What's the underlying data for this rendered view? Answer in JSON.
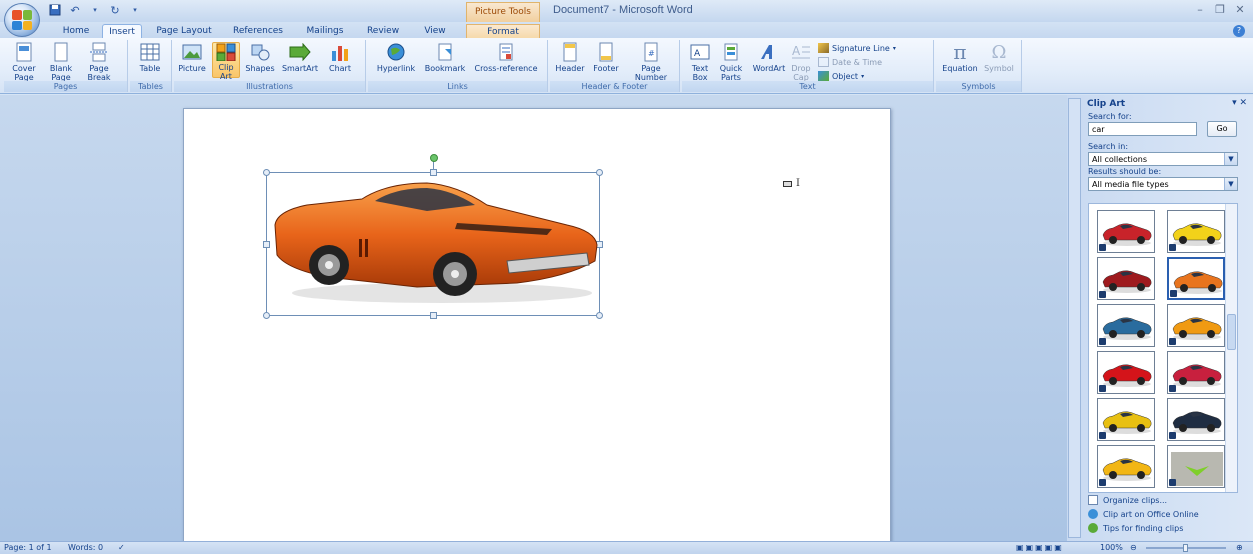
{
  "window": {
    "title": "Document7 - Microsoft Word",
    "context_tab_group": "Picture Tools"
  },
  "tabs": [
    "Home",
    "Insert",
    "Page Layout",
    "References",
    "Mailings",
    "Review",
    "View",
    "Format"
  ],
  "active_tab": "Insert",
  "ribbon": {
    "groups": {
      "pages": "Pages",
      "tables": "Tables",
      "illustrations": "Illustrations",
      "links": "Links",
      "header_footer": "Header & Footer",
      "text": "Text",
      "symbols": "Symbols"
    },
    "buttons": {
      "cover_page": "Cover Page",
      "blank_page": "Blank Page",
      "page_break": "Page Break",
      "table": "Table",
      "picture": "Picture",
      "clip_art": "Clip Art",
      "shapes": "Shapes",
      "smartart": "SmartArt",
      "chart": "Chart",
      "hyperlink": "Hyperlink",
      "bookmark": "Bookmark",
      "cross_reference": "Cross-reference",
      "header": "Header",
      "footer": "Footer",
      "page_number": "Page Number",
      "text_box": "Text Box",
      "quick_parts": "Quick Parts",
      "wordart": "WordArt",
      "drop_cap": "Drop Cap",
      "signature_line": "Signature Line",
      "date_time": "Date & Time",
      "object": "Object",
      "equation": "Equation",
      "symbol": "Symbol"
    }
  },
  "taskpane": {
    "title": "Clip Art",
    "search_for_label": "Search for:",
    "search_value": "car",
    "go_label": "Go",
    "search_in_label": "Search in:",
    "search_in_value": "All collections",
    "results_label": "Results should be:",
    "results_value": "All media file types",
    "clips": [
      {
        "color": "#c8232a"
      },
      {
        "color": "#f2d21a"
      },
      {
        "color": "#9e1a1e"
      },
      {
        "color": "#e8741e"
      },
      {
        "color": "#2a6c9e"
      },
      {
        "color": "#f09a12"
      },
      {
        "color": "#d4141a"
      },
      {
        "color": "#c8203e"
      },
      {
        "color": "#e8c012"
      },
      {
        "color": "#1f2d42"
      },
      {
        "color": "#f2b614"
      },
      {
        "color": "#7fcf2a"
      }
    ],
    "links": {
      "organize": "Organize clips...",
      "online": "Clip art on Office Online",
      "tips": "Tips for finding clips"
    }
  },
  "statusbar": {
    "page": "Page: 1 of 1",
    "words": "Words: 0",
    "zoom": "100%"
  }
}
